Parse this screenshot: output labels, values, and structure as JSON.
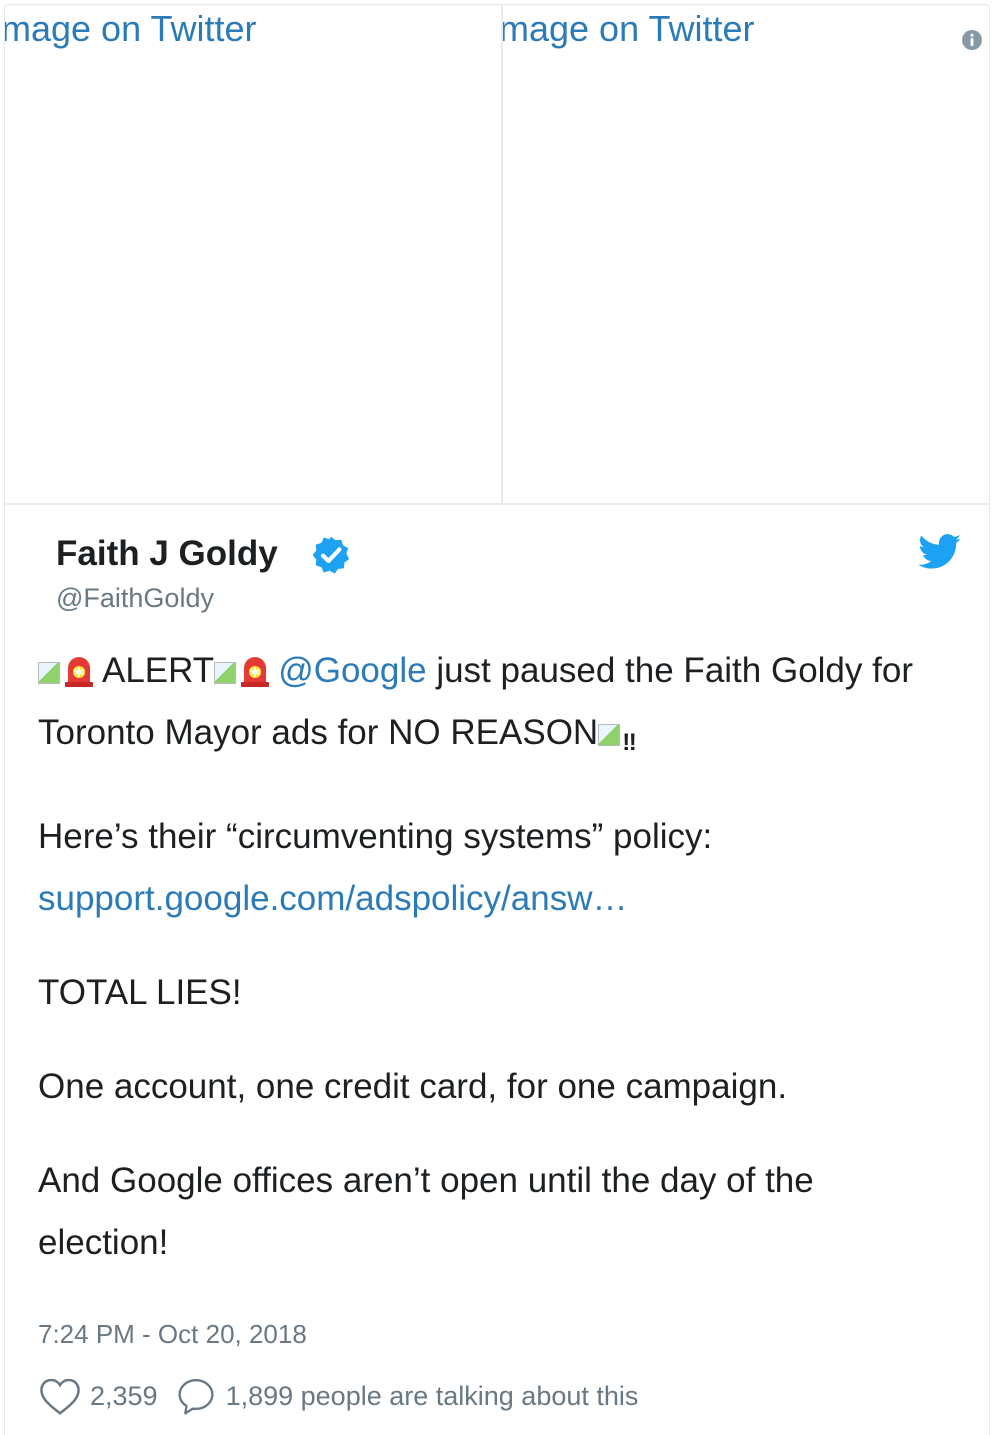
{
  "media": {
    "left_alt": "mage on Twitter",
    "right_alt": "mage on Twitter"
  },
  "author": {
    "name": "Faith J Goldy",
    "handle": "@FaithGoldy",
    "verified": true
  },
  "tweet": {
    "line1_word": "ALERT",
    "mention": "@Google",
    "line1_rest": " just paused the Faith Goldy for Toronto Mayor ads for NO REASON",
    "double_exclamation": "‼",
    "para2_text": "Here’s their “circumventing systems” policy:",
    "para2_link": "support.google.com/adspolicy/answ…",
    "para3": "TOTAL LIES!",
    "para4": "One account, one credit card, for one campaign.",
    "para5": "And Google offices aren’t open until the day of the election!"
  },
  "timestamp": "7:24 PM - Oct 20, 2018",
  "stats": {
    "likes": "2,359",
    "talking": "1,899 people are talking about this"
  },
  "icons": {
    "info": "info-icon",
    "verified": "verified-badge-icon",
    "twitter": "twitter-bird-icon",
    "siren": "police-siren-emoji",
    "heart": "heart-icon",
    "reply": "reply-bubble-icon"
  },
  "colors": {
    "link": "#2b7bb9",
    "twitter_blue": "#1da1f2",
    "muted": "#697882",
    "text": "#1c2022"
  }
}
